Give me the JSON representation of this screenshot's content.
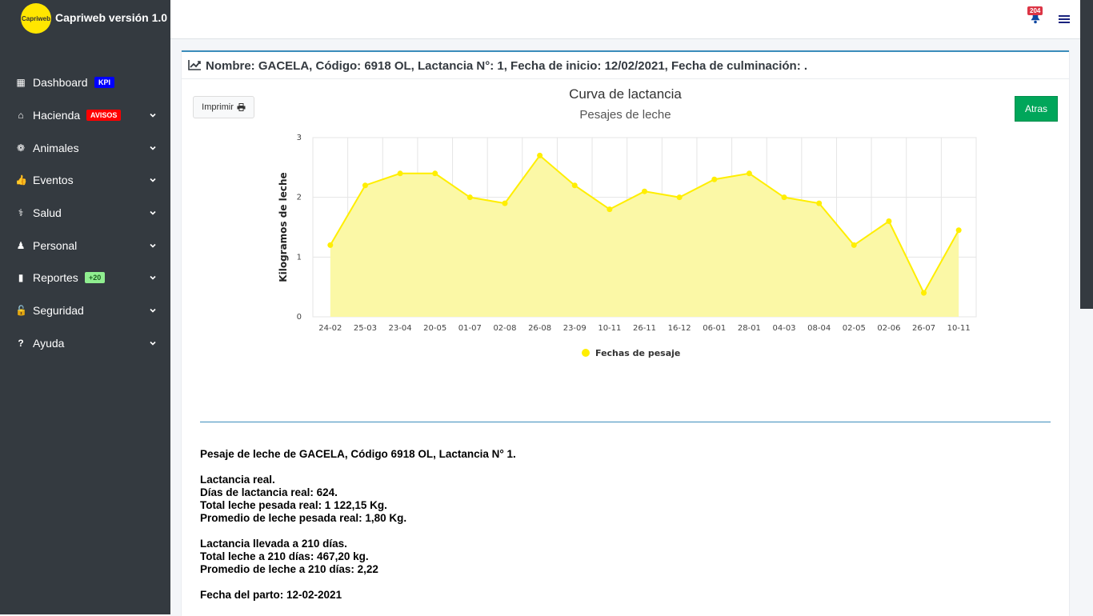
{
  "app": {
    "brand_title": "Capriweb versión 1.0",
    "brand_logo_text": "Capriweb"
  },
  "sidebar": {
    "items": [
      {
        "label": "Dashboard",
        "icon": "grid-icon",
        "badge": "KPI",
        "badge_color": "#0000ff",
        "has_chevron": false
      },
      {
        "label": "Hacienda",
        "icon": "home-icon",
        "badge": "AVISOS",
        "badge_color": "#ff0000",
        "has_chevron": true
      },
      {
        "label": "Animales",
        "icon": "paw-icon",
        "badge": "",
        "has_chevron": true
      },
      {
        "label": "Eventos",
        "icon": "thumbs-up-icon",
        "badge": "",
        "has_chevron": true
      },
      {
        "label": "Salud",
        "icon": "stethoscope-icon",
        "badge": "",
        "has_chevron": true
      },
      {
        "label": "Personal",
        "icon": "user-secret-icon",
        "badge": "",
        "has_chevron": true
      },
      {
        "label": "Reportes",
        "icon": "file-icon",
        "badge": "+20",
        "badge_color": "#90ee90",
        "has_chevron": true
      },
      {
        "label": "Seguridad",
        "icon": "unlock-icon",
        "badge": "",
        "has_chevron": true
      },
      {
        "label": "Ayuda",
        "icon": "question-icon",
        "badge": "",
        "has_chevron": true
      }
    ]
  },
  "header": {
    "notifications_count": "204"
  },
  "card": {
    "title": "Nombre: GACELA, Código: 6918 OL, Lactancia N°: 1, Fecha de inicio: 12/02/2021, Fecha de culminación: .",
    "print_label": "Imprimir",
    "back_label": "Atras"
  },
  "chart_data": {
    "type": "area",
    "title": "Curva de lactancia",
    "subtitle": "Pesajes de leche",
    "ylabel": "Kilogramos de leche",
    "xlabel": "",
    "ylim": [
      0,
      3
    ],
    "yticks": [
      "0",
      "1",
      "2",
      "3"
    ],
    "categories": [
      "24-02",
      "25-03",
      "23-04",
      "20-05",
      "01-07",
      "02-08",
      "26-08",
      "23-09",
      "10-11",
      "26-11",
      "16-12",
      "06-01",
      "28-01",
      "04-03",
      "08-04",
      "02-05",
      "02-06",
      "26-07",
      "10-11"
    ],
    "series": [
      {
        "name": "Fechas de pesaje",
        "color": "#ffee00",
        "fill": "#fbf8a6",
        "values": [
          1.2,
          2.2,
          2.4,
          2.4,
          2.0,
          1.9,
          2.7,
          2.2,
          1.8,
          2.1,
          2.0,
          2.3,
          2.4,
          2.0,
          1.9,
          1.2,
          1.6,
          0.4,
          1.45
        ]
      }
    ],
    "grid": true,
    "legend": "bottom"
  },
  "summary": {
    "heading": "Pesaje de leche de GACELA, Código 6918 OL, Lactancia N° 1.",
    "real_title": "Lactancia real.",
    "real_days": "Días de lactancia real: 624.",
    "real_total": "Total leche pesada real: 1 122,15 Kg.",
    "real_avg": "Promedio de leche pesada real: 1,80 Kg.",
    "l210_title": "Lactancia llevada a 210 días.",
    "l210_total": "Total leche a 210 días: 467,20 kg.",
    "l210_avg": "Promedio de leche a 210 días: 2,22",
    "birth_date": "Fecha del parto: 12-02-2021"
  },
  "colors": {
    "sidebar_bg": "#343a40",
    "accent": "#3c8dbc",
    "back_button": "#00a65a"
  }
}
